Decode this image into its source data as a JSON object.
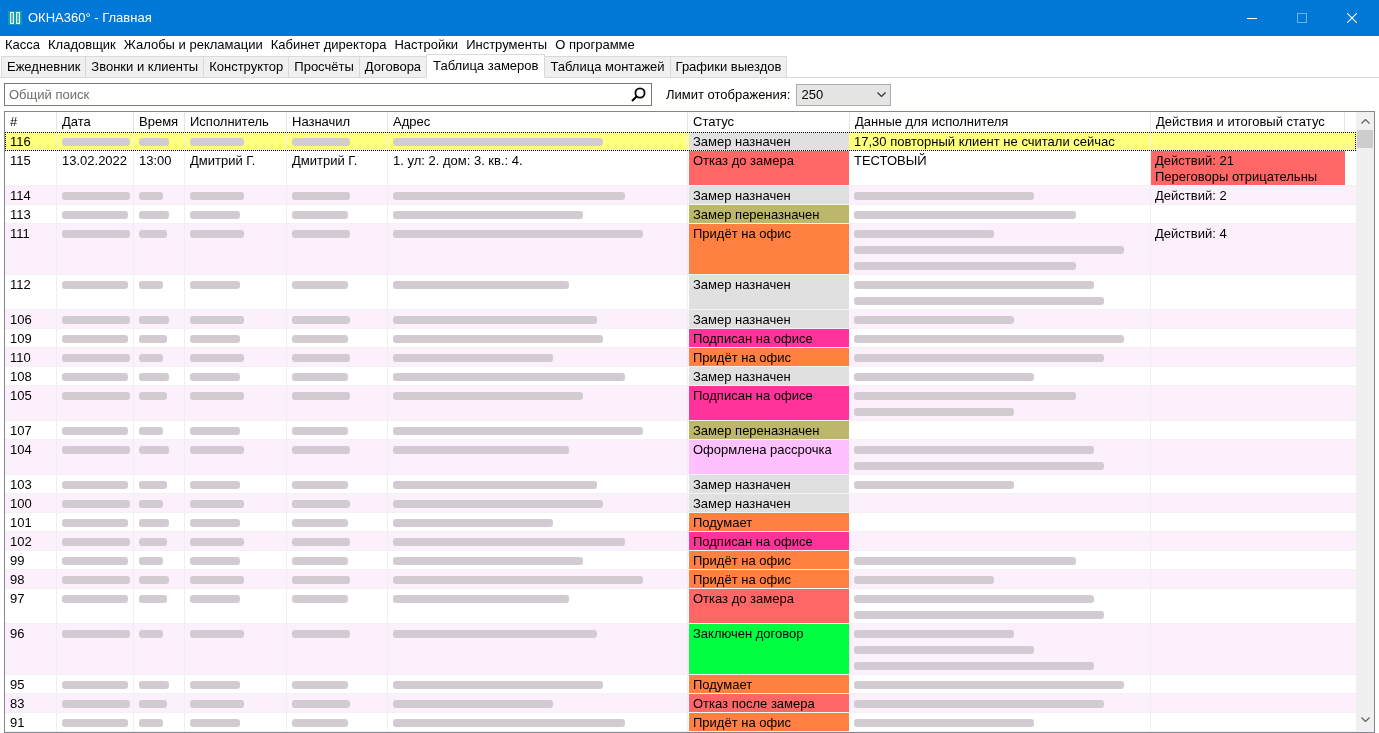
{
  "window": {
    "title": "ОКНА360° - Главная",
    "controls": [
      {
        "kind": "minimize",
        "disabled": false
      },
      {
        "kind": "maximize",
        "disabled": true
      },
      {
        "kind": "close",
        "disabled": false
      }
    ]
  },
  "menu": [
    "Касса",
    "Кладовщик",
    "Жалобы и рекламации",
    "Кабинет директора",
    "Настройки",
    "Инструменты",
    "О программе"
  ],
  "tabs": [
    {
      "label": "Ежедневник",
      "selected": false
    },
    {
      "label": "Звонки и клиенты",
      "selected": false
    },
    {
      "label": "Конструктор",
      "selected": false
    },
    {
      "label": "Просчёты",
      "selected": false
    },
    {
      "label": "Договора",
      "selected": false
    },
    {
      "label": "Таблица замеров",
      "selected": true
    },
    {
      "label": "Таблица монтажей",
      "selected": false
    },
    {
      "label": "Графики выездов",
      "selected": false
    }
  ],
  "search": {
    "placeholder": "Общий поиск"
  },
  "display_limit": {
    "label": "Лимит отображения:",
    "value": "250"
  },
  "table": {
    "columns": [
      "#",
      "Дата",
      "Время",
      "Исполнитель",
      "Назначил",
      "Адрес",
      "Статус",
      "Данные для исполнителя",
      "Действия и итоговый статус"
    ],
    "rows": [
      {
        "selected": true,
        "num": "116",
        "blurred": true,
        "status": {
          "label": "Замер назначен",
          "color": "#e0e0e0"
        },
        "data": [
          {
            "kind": "text",
            "text": "17,30 повторный клиент не считали сейчас"
          }
        ]
      },
      {
        "selected": false,
        "num": "115",
        "blurred": false,
        "date": "13.02.2022",
        "time": "13:00",
        "executor": "Дмитрий Г.",
        "assigned": "Дмитрий Г.",
        "address": "1. ул: 2. дом: 3. кв.: 4.",
        "status": {
          "label": "Отказ до замера",
          "color": "#ff6666"
        },
        "data": [
          {
            "kind": "text",
            "text": "ТЕСТОВЫЙ"
          }
        ],
        "actions": {
          "lines": [
            "Действий: 21",
            "Переговоры отрицательны"
          ],
          "color": "#ff6666"
        }
      },
      {
        "selected": false,
        "num": "114",
        "blurred": true,
        "status": {
          "label": "Замер назначен",
          "color": "#e0e0e0"
        },
        "data": [
          {
            "kind": "blurred"
          }
        ],
        "actions": {
          "lines": [
            "Действий: 2"
          ]
        }
      },
      {
        "selected": false,
        "num": "113",
        "blurred": true,
        "status": {
          "label": "Замер переназначен",
          "color": "#bdb76b"
        },
        "data": [
          {
            "kind": "blurred"
          }
        ]
      },
      {
        "selected": false,
        "num": "111",
        "blurred": true,
        "status": {
          "label": "Придёт на офис",
          "color": "#ff8040"
        },
        "data": [
          {
            "kind": "blurred"
          },
          {
            "kind": "blurred"
          },
          {
            "kind": "blurred"
          }
        ],
        "actions": {
          "lines": [
            "Действий: 4"
          ]
        }
      },
      {
        "selected": false,
        "num": "112",
        "blurred": true,
        "status": {
          "label": "Замер назначен",
          "color": "#e0e0e0"
        },
        "data": [
          {
            "kind": "blurred"
          },
          {
            "kind": "blurred"
          }
        ]
      },
      {
        "selected": false,
        "num": "106",
        "blurred": true,
        "status": {
          "label": "Замер назначен",
          "color": "#e0e0e0"
        },
        "data": [
          {
            "kind": "blurred"
          }
        ]
      },
      {
        "selected": false,
        "num": "109",
        "blurred": true,
        "status": {
          "label": "Подписан на офисе",
          "color": "#ff3399"
        },
        "data": [
          {
            "kind": "blurred"
          }
        ]
      },
      {
        "selected": false,
        "num": "110",
        "blurred": true,
        "status": {
          "label": "Придёт на офис",
          "color": "#ff8040"
        },
        "data": [
          {
            "kind": "blurred"
          }
        ]
      },
      {
        "selected": false,
        "num": "108",
        "blurred": true,
        "status": {
          "label": "Замер назначен",
          "color": "#e0e0e0"
        },
        "data": [
          {
            "kind": "blurred"
          }
        ]
      },
      {
        "selected": false,
        "num": "105",
        "blurred": true,
        "status": {
          "label": "Подписан на офисе",
          "color": "#ff3399"
        },
        "data": [
          {
            "kind": "blurred"
          },
          {
            "kind": "blurred"
          }
        ]
      },
      {
        "selected": false,
        "num": "107",
        "blurred": true,
        "status": {
          "label": "Замер переназначен",
          "color": "#bdb76b"
        }
      },
      {
        "selected": false,
        "num": "104",
        "blurred": true,
        "status": {
          "label": "Оформлена рассрочка",
          "color": "#ffc0ff"
        },
        "data": [
          {
            "kind": "blurred"
          },
          {
            "kind": "blurred"
          }
        ]
      },
      {
        "selected": false,
        "num": "103",
        "blurred": true,
        "status": {
          "label": "Замер назначен",
          "color": "#e0e0e0"
        },
        "data": [
          {
            "kind": "blurred"
          }
        ]
      },
      {
        "selected": false,
        "num": "100",
        "blurred": true,
        "status": {
          "label": "Замер назначен",
          "color": "#e0e0e0"
        }
      },
      {
        "selected": false,
        "num": "101",
        "blurred": true,
        "status": {
          "label": "Подумает",
          "color": "#ff8040"
        }
      },
      {
        "selected": false,
        "num": "102",
        "blurred": true,
        "status": {
          "label": "Подписан на офисе",
          "color": "#ff3399"
        }
      },
      {
        "selected": false,
        "num": "99",
        "blurred": true,
        "status": {
          "label": "Придёт на офис",
          "color": "#ff8040"
        },
        "data": [
          {
            "kind": "blurred"
          }
        ]
      },
      {
        "selected": false,
        "num": "98",
        "blurred": true,
        "status": {
          "label": "Придёт на офис",
          "color": "#ff8040"
        },
        "data": [
          {
            "kind": "blurred"
          }
        ]
      },
      {
        "selected": false,
        "num": "97",
        "blurred": true,
        "status": {
          "label": "Отказ до замера",
          "color": "#ff6666"
        },
        "data": [
          {
            "kind": "blurred"
          },
          {
            "kind": "blurred"
          }
        ]
      },
      {
        "selected": false,
        "num": "96",
        "blurred": true,
        "status": {
          "label": "Заключен договор",
          "color": "#00ff40"
        },
        "data": [
          {
            "kind": "blurred"
          },
          {
            "kind": "blurred"
          },
          {
            "kind": "blurred"
          }
        ]
      },
      {
        "selected": false,
        "num": "95",
        "blurred": true,
        "status": {
          "label": "Подумает",
          "color": "#ff8040"
        },
        "data": [
          {
            "kind": "blurred"
          }
        ]
      },
      {
        "selected": false,
        "num": "83",
        "blurred": true,
        "status": {
          "label": "Отказ после замера",
          "color": "#ff6666"
        },
        "data": [
          {
            "kind": "blurred"
          }
        ]
      },
      {
        "selected": false,
        "num": "91",
        "blurred": true,
        "status": {
          "label": "Придёт на офис",
          "color": "#ff8040"
        },
        "data": [
          {
            "kind": "blurred"
          }
        ]
      }
    ]
  }
}
